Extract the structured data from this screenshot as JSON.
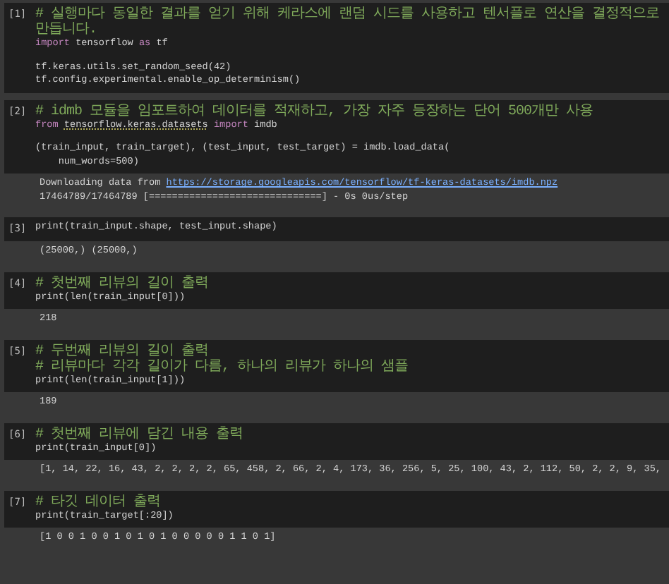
{
  "cells": [
    {
      "prompt": "[1]",
      "code": [
        {
          "segments": [
            {
              "kind": "comment",
              "text": "# 실행마다 동일한 결과를 얻기 위해 케라스에 랜덤 시드를 사용하고 텐서플로 연산을 결정적으로 만듭니다."
            }
          ]
        },
        {
          "segments": [
            {
              "kind": "keyword",
              "text": "import"
            },
            {
              "kind": "plain",
              "text": " tensorflow "
            },
            {
              "kind": "keyword",
              "text": "as"
            },
            {
              "kind": "plain",
              "text": " tf"
            }
          ]
        },
        {
          "spaced": true,
          "segments": [
            {
              "kind": "plain",
              "text": "tf.keras.utils.set_random_seed(42)"
            }
          ]
        },
        {
          "segments": [
            {
              "kind": "plain",
              "text": "tf.config.experimental.enable_op_determinism()"
            }
          ]
        }
      ]
    },
    {
      "prompt": "[2]",
      "code": [
        {
          "segments": [
            {
              "kind": "comment",
              "text": "# idmb 모듈을 임포트하여 데이터를 적재하고, 가장 자주 등장하는 단어 500개만 사용"
            }
          ]
        },
        {
          "segments": [
            {
              "kind": "keyword",
              "text": "from "
            },
            {
              "kind": "module",
              "text": "tensorflow.keras.datasets"
            },
            {
              "kind": "keyword",
              "text": " import"
            },
            {
              "kind": "plain",
              "text": " imdb"
            }
          ]
        },
        {
          "spaced": true,
          "segments": [
            {
              "kind": "plain",
              "text": "(train_input, train_target), (test_input, test_target) = imdb.load_data("
            }
          ]
        },
        {
          "segments": [
            {
              "kind": "plain",
              "text": "    num_words=500)"
            }
          ]
        }
      ],
      "output": [
        {
          "segments": [
            {
              "kind": "plain",
              "text": "Downloading data from "
            },
            {
              "kind": "link",
              "text": "https://storage.googleapis.com/tensorflow/tf-keras-datasets/imdb.npz"
            }
          ]
        },
        {
          "segments": [
            {
              "kind": "plain",
              "text": "17464789/17464789 [==============================] - 0s 0us/step"
            }
          ]
        }
      ]
    },
    {
      "prompt": "[3]",
      "code": [
        {
          "segments": [
            {
              "kind": "plain",
              "text": "print(train_input.shape, test_input.shape)"
            }
          ]
        }
      ],
      "output": [
        {
          "segments": [
            {
              "kind": "plain",
              "text": "(25000,) (25000,)"
            }
          ]
        }
      ]
    },
    {
      "prompt": "[4]",
      "code": [
        {
          "segments": [
            {
              "kind": "comment",
              "text": "# 첫번째 리뷰의 길이 출력"
            }
          ]
        },
        {
          "segments": [
            {
              "kind": "plain",
              "text": "print(len(train_input[0]))"
            }
          ]
        }
      ],
      "output": [
        {
          "segments": [
            {
              "kind": "plain",
              "text": "218"
            }
          ]
        }
      ]
    },
    {
      "prompt": "[5]",
      "code": [
        {
          "segments": [
            {
              "kind": "comment",
              "text": "# 두번째 리뷰의 길이 출력"
            }
          ]
        },
        {
          "segments": [
            {
              "kind": "comment",
              "text": "# 리뷰마다 각각 길이가 다름, 하나의 리뷰가 하나의 샘플"
            }
          ]
        },
        {
          "segments": [
            {
              "kind": "plain",
              "text": "print(len(train_input[1]))"
            }
          ]
        }
      ],
      "output": [
        {
          "segments": [
            {
              "kind": "plain",
              "text": "189"
            }
          ]
        }
      ]
    },
    {
      "prompt": "[6]",
      "code": [
        {
          "segments": [
            {
              "kind": "comment",
              "text": "# 첫번째 리뷰에 담긴 내용 출력"
            }
          ]
        },
        {
          "segments": [
            {
              "kind": "plain",
              "text": "print(train_input[0])"
            }
          ]
        }
      ],
      "output": [
        {
          "segments": [
            {
              "kind": "plain",
              "text": "[1, 14, 22, 16, 43, 2, 2, 2, 2, 65, 458, 2, 66, 2, 4, 173, 36, 256, 5, 25, 100, 43, 2, 112, 50, 2, 2, 9, 35,"
            }
          ]
        }
      ]
    },
    {
      "prompt": "[7]",
      "code": [
        {
          "segments": [
            {
              "kind": "comment",
              "text": "# 타깃 데이터 출력"
            }
          ]
        },
        {
          "segments": [
            {
              "kind": "plain",
              "text": "print(train_target[:20])"
            }
          ]
        }
      ],
      "output": [
        {
          "segments": [
            {
              "kind": "plain",
              "text": "[1 0 0 1 0 0 1 0 1 0 1 0 0 0 0 0 1 1 0 1]"
            }
          ]
        }
      ]
    }
  ]
}
